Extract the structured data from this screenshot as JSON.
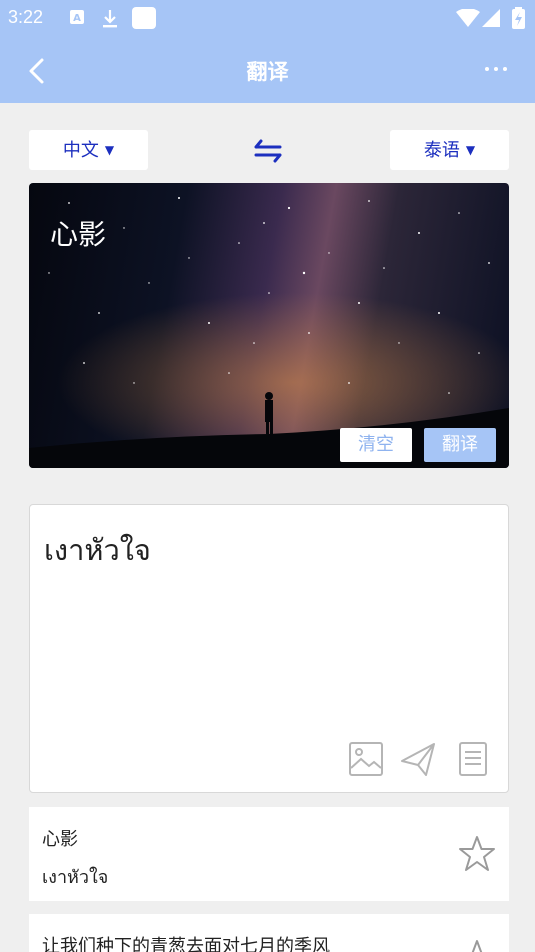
{
  "status_bar": {
    "time": "3:22",
    "icons": [
      "a-notification-icon",
      "download-icon",
      "square-app-icon",
      "wifi-icon",
      "signal-icon",
      "battery-charging-icon"
    ]
  },
  "app_bar": {
    "title": "翻译",
    "back_icon": "chevron-left-icon",
    "more_icon": "more-dots-icon"
  },
  "language_selector": {
    "source": "中文",
    "target": "泰语",
    "swap_icon": "swap-arrows-icon"
  },
  "input": {
    "text": "心影",
    "clear_label": "清空",
    "translate_label": "翻译"
  },
  "result": {
    "text": "เงาหัวใจ",
    "actions": [
      "image-icon",
      "send-icon",
      "document-icon"
    ]
  },
  "history": [
    {
      "source": "心影",
      "target": "เงาหัวใจ",
      "favorite_icon": "star-outline-icon"
    },
    {
      "source": "让我们种下的青葱去面对七月的季风",
      "target": "",
      "favorite_icon": "star-outline-icon"
    }
  ],
  "colors": {
    "accent": "#a6c5f6",
    "language_text": "#1c2fbf",
    "background": "#efefef"
  }
}
